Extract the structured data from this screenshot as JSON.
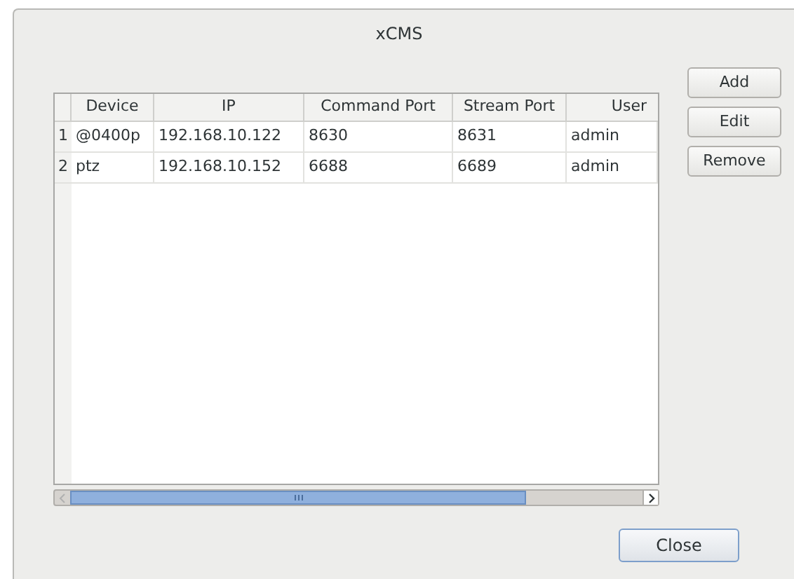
{
  "window": {
    "title": "xCMS"
  },
  "table": {
    "columns": [
      "Device",
      "IP",
      "Command Port",
      "Stream Port",
      "User"
    ],
    "rows": [
      {
        "number": "1",
        "cells": [
          "@0400p",
          "192.168.10.122",
          "8630",
          "8631",
          "admin"
        ]
      },
      {
        "number": "2",
        "cells": [
          "ptz",
          "192.168.10.152",
          "6688",
          "6689",
          "admin"
        ]
      }
    ]
  },
  "side_buttons": [
    "Add",
    "Edit",
    "Remove"
  ],
  "footer_buttons": [
    {
      "label": "Close",
      "default": true
    }
  ]
}
